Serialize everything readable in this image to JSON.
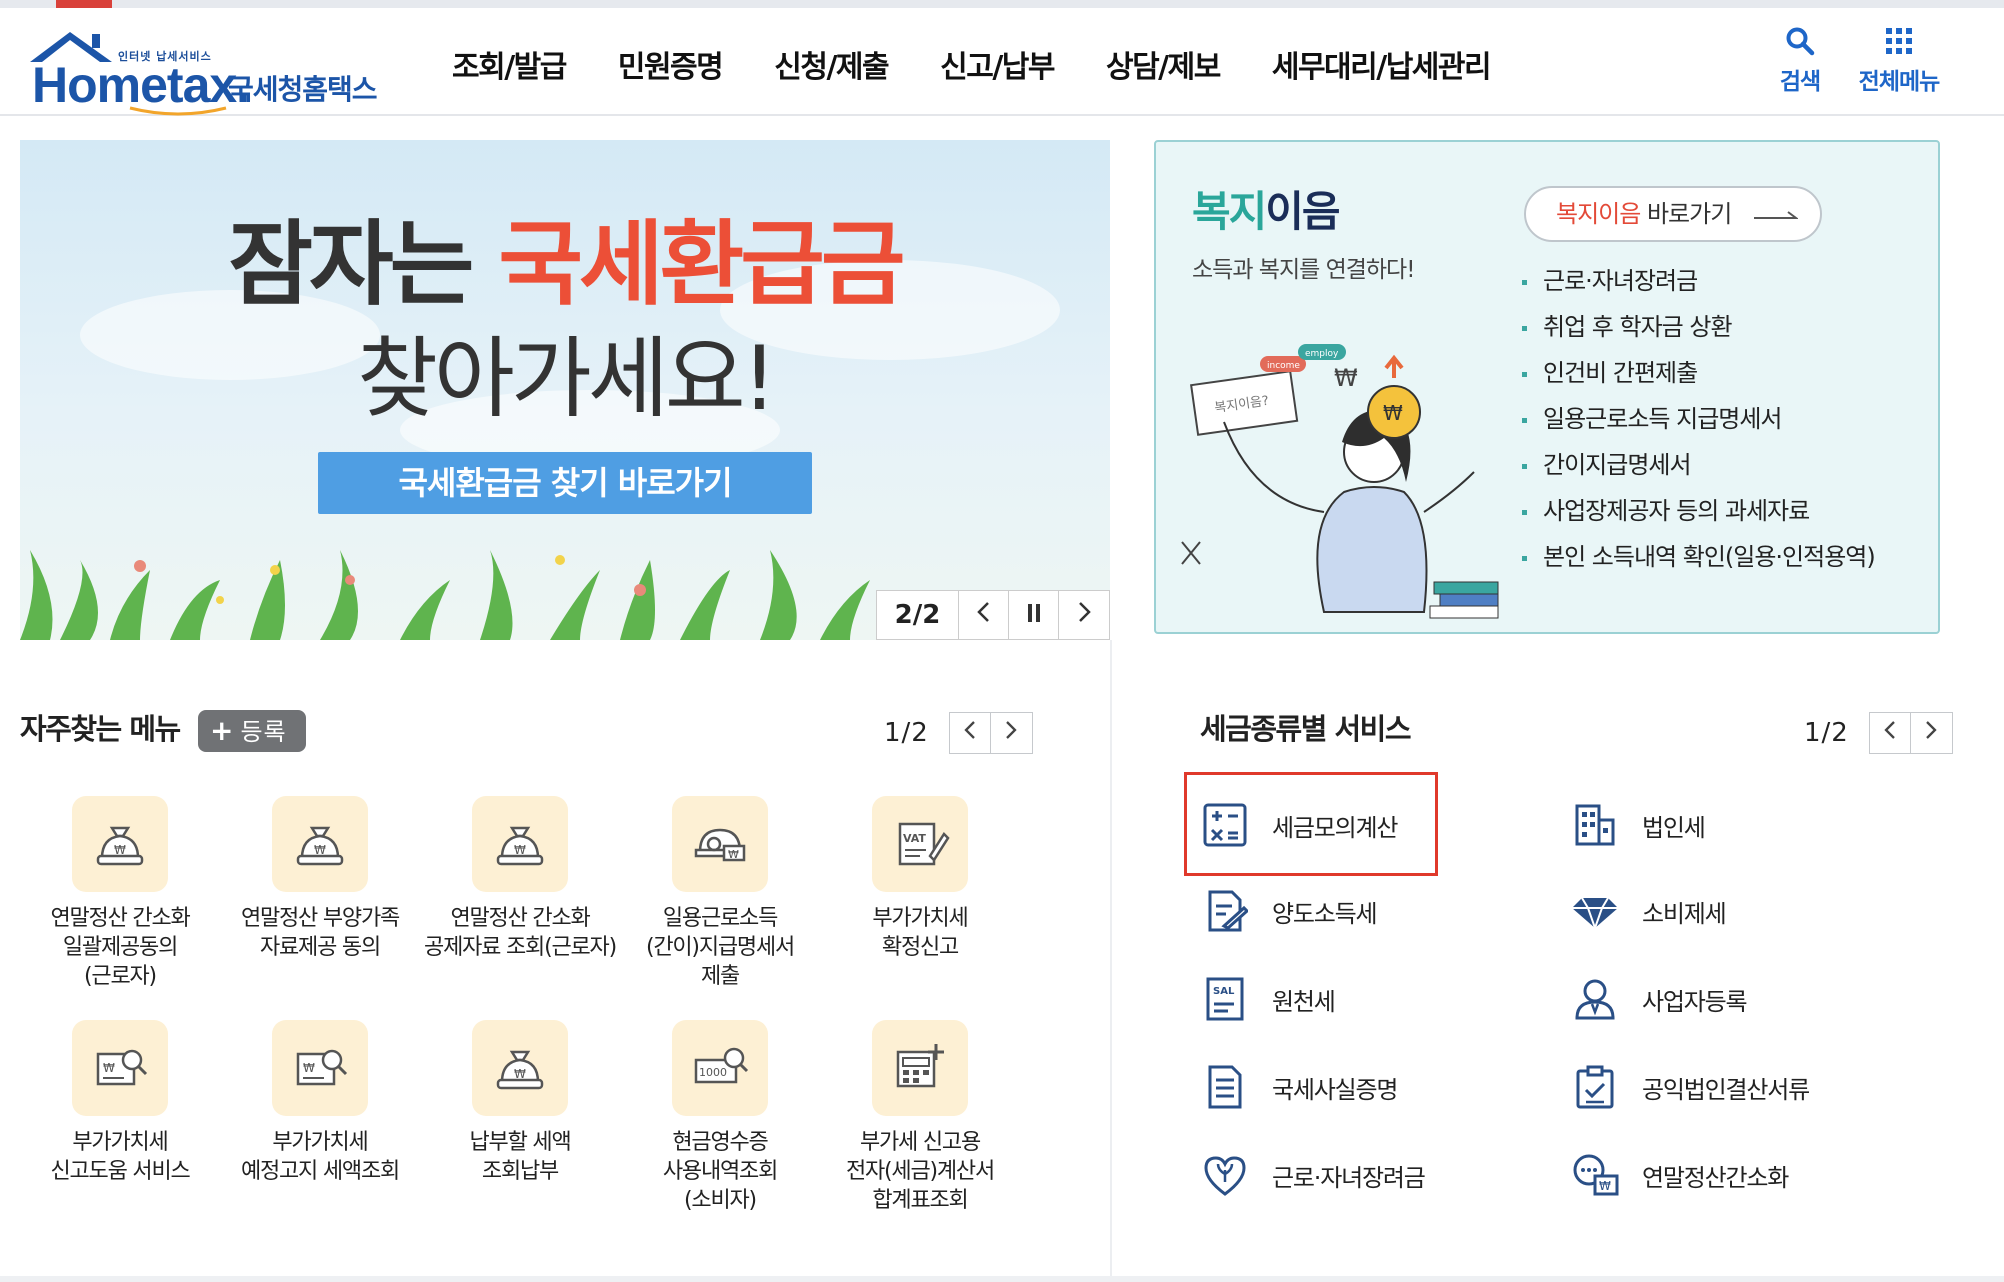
{
  "header": {
    "logo_tagline": "인터넷 납세서비스",
    "logo_brand": "Hometax.",
    "logo_name": "국세청홈택스",
    "gnb": [
      "조회/발급",
      "민원증명",
      "신청/제출",
      "신고/납부",
      "상담/제보",
      "세무대리/납세관리"
    ],
    "search_label": "검색",
    "allmenu_label": "전체메뉴",
    "accent_color": "#1e66c8"
  },
  "banner": {
    "headline_dark": "잠자는",
    "headline_red": "국세환급금",
    "headline2": "찾아가세요!",
    "cta_label": "국세환급금 찾기 바로가기",
    "page": "2/2",
    "prev_icon": "chevron-left-icon",
    "pause_icon": "pause-icon",
    "next_icon": "chevron-right-icon"
  },
  "welfare": {
    "title_green": "복지",
    "title_dark": "이음",
    "subtitle": "소득과 복지를 연결하다!",
    "link_red": "복지이음",
    "link_text": " 바로가기",
    "items": [
      "근로·자녀장려금",
      "취업 후 학자금 상환",
      "인건비 간편제출",
      "일용근로소득 지급명세서",
      "간이지급명세서",
      "사업장제공자 등의 과세자료",
      "본인 소득내역 확인(일용·인적용역)"
    ],
    "illu_bubble": "복지이음?",
    "illu_tag1": "income",
    "illu_tag2": "employ"
  },
  "frequent": {
    "title": "자주찾는 메뉴",
    "register_label": "등록",
    "page": "1/2",
    "items": [
      {
        "lines": [
          "연말정산 간소화",
          "일괄제공동의",
          "(근로자)"
        ],
        "icon": "money-bag-icon"
      },
      {
        "lines": [
          "연말정산 부양가족",
          "자료제공 동의"
        ],
        "icon": "money-bag-icon"
      },
      {
        "lines": [
          "연말정산 간소화",
          "공제자료 조회(근로자)"
        ],
        "icon": "money-bag-icon"
      },
      {
        "lines": [
          "일용근로소득",
          "(간이)지급명세서",
          "제출"
        ],
        "icon": "helmet-won-icon"
      },
      {
        "lines": [
          "부가가치세",
          "확정신고"
        ],
        "icon": "vat-document-icon"
      },
      {
        "lines": [
          "부가가치세",
          "신고도움 서비스"
        ],
        "icon": "won-search-icon"
      },
      {
        "lines": [
          "부가가치세",
          "예정고지 세액조회"
        ],
        "icon": "won-search-icon"
      },
      {
        "lines": [
          "납부할 세액",
          "조회납부"
        ],
        "icon": "money-bag-icon"
      },
      {
        "lines": [
          "현금영수증",
          "사용내역조회",
          "(소비자)"
        ],
        "icon": "receipt-search-icon"
      },
      {
        "lines": [
          "부가세 신고용",
          "전자(세금)계산서",
          "합계표조회"
        ],
        "icon": "calculator-doc-icon"
      }
    ]
  },
  "tax": {
    "title": "세금종류별 서비스",
    "page": "1/2",
    "items": [
      {
        "label": "세금모의계산",
        "icon": "calculator-icon"
      },
      {
        "label": "법인세",
        "icon": "building-icon"
      },
      {
        "label": "양도소득세",
        "icon": "document-sign-icon"
      },
      {
        "label": "소비제세",
        "icon": "diamond-icon"
      },
      {
        "label": "원천세",
        "icon": "salary-doc-icon"
      },
      {
        "label": "사업자등록",
        "icon": "person-icon"
      },
      {
        "label": "국세사실증명",
        "icon": "document-icon"
      },
      {
        "label": "공익법인결산서류",
        "icon": "clipboard-check-icon"
      },
      {
        "label": "근로·자녀장려금",
        "icon": "heart-sprout-icon"
      },
      {
        "label": "연말정산간소화",
        "icon": "chat-won-icon"
      }
    ],
    "highlighted": "세금모의계산",
    "highlight_color": "#e0392b"
  }
}
